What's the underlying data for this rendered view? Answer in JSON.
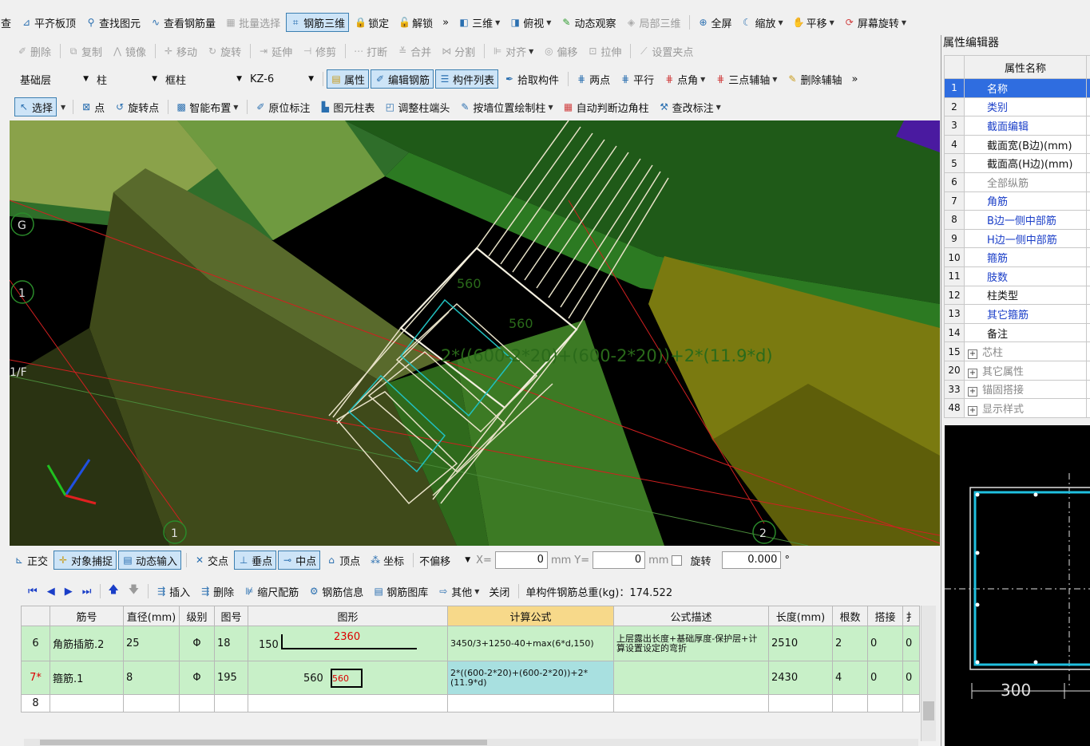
{
  "toolbar1": {
    "items": [
      "查",
      "平齐板顶",
      "查找图元",
      "查看钢筋量",
      "批量选择",
      "钢筋三维",
      "锁定",
      "解锁",
      "»",
      "三维",
      "俯视",
      "动态观察",
      "局部三维",
      "全屏",
      "缩放",
      "平移",
      "屏幕旋转"
    ]
  },
  "toolbar2": {
    "items": [
      "删除",
      "复制",
      "镜像",
      "移动",
      "旋转",
      "延伸",
      "修剪",
      "打断",
      "合并",
      "分割",
      "对齐",
      "偏移",
      "拉伸",
      "设置夹点"
    ]
  },
  "toolbar3": {
    "layer": "基础层",
    "category": "柱",
    "type": "框柱",
    "component": "KZ-6",
    "buttons": [
      "属性",
      "编辑钢筋",
      "构件列表",
      "拾取构件",
      "两点",
      "平行",
      "点角",
      "三点辅轴",
      "删除辅轴"
    ],
    "more": "»"
  },
  "toolbar4": {
    "items": [
      "选择",
      "点",
      "旋转点",
      "智能布置",
      "原位标注",
      "图元柱表",
      "调整柱端头",
      "按墙位置绘制柱",
      "自动判断边角柱",
      "查改标注"
    ]
  },
  "viewport": {
    "axis_labels": [
      "G",
      "1",
      "1/F",
      "1",
      "2"
    ],
    "formula_overlay": "2*((600-2*20)+(600-2*20))+2*(11.9*d)",
    "dim_labels": [
      "560",
      "560"
    ]
  },
  "snapbar": {
    "items": [
      "正交",
      "对象捕捉",
      "动态输入",
      "交点",
      "垂点",
      "中点",
      "顶点",
      "坐标"
    ],
    "offset_mode": "不偏移",
    "x_label": "X=",
    "x_value": "0",
    "y_label": "Y=",
    "y_value": "0",
    "unit": "mm",
    "rotate_label": "旋转",
    "rotate_value": "0.000",
    "degree": "°"
  },
  "rebar_toolbar": {
    "items": [
      "插入",
      "删除",
      "缩尺配筋",
      "钢筋信息",
      "钢筋图库",
      "其他",
      "关闭"
    ],
    "total": "单构件钢筋总重(kg)：174.522"
  },
  "grid": {
    "headers": [
      "",
      "筋号",
      "直径(mm)",
      "级别",
      "图号",
      "图形",
      "计算公式",
      "公式描述",
      "长度(mm)",
      "根数",
      "搭接",
      "扌"
    ],
    "rows": [
      {
        "no": "6",
        "name": "角筋插筋.2",
        "dia": "25",
        "grade": "Φ",
        "fig": "18",
        "shape_left": "150",
        "shape_mid": "2360",
        "formula": "3450/3+1250-40+max(6*d,150)",
        "desc": "上层露出长度+基础厚度-保护层+计算设置设定的弯折",
        "len": "2510",
        "count": "2",
        "lap": "0",
        "extra": "0"
      },
      {
        "no": "7*",
        "name": "箍筋.1",
        "dia": "8",
        "grade": "Φ",
        "fig": "195",
        "shape_left": "560",
        "shape_mid": "560",
        "formula": "2*((600-2*20)+(600-2*20))+2*(11.9*d)",
        "desc": "",
        "len": "2430",
        "count": "4",
        "lap": "0",
        "extra": "0"
      },
      {
        "no": "8",
        "name": "",
        "dia": "",
        "grade": "",
        "fig": "",
        "shape_left": "",
        "shape_mid": "",
        "formula": "",
        "desc": "",
        "len": "",
        "count": "",
        "lap": "",
        "extra": ""
      }
    ]
  },
  "prop_panel": {
    "title": "属性编辑器",
    "header": "属性名称",
    "rows": [
      {
        "n": "1",
        "label": "名称",
        "style": "blue",
        "selected": true
      },
      {
        "n": "2",
        "label": "类别",
        "style": "blue"
      },
      {
        "n": "3",
        "label": "截面编辑",
        "style": "blue"
      },
      {
        "n": "4",
        "label": "截面宽(B边)(mm)",
        "style": "black"
      },
      {
        "n": "5",
        "label": "截面高(H边)(mm)",
        "style": "black"
      },
      {
        "n": "6",
        "label": "全部纵筋",
        "style": "gray"
      },
      {
        "n": "7",
        "label": "角筋",
        "style": "blue"
      },
      {
        "n": "8",
        "label": "B边一侧中部筋",
        "style": "blue"
      },
      {
        "n": "9",
        "label": "H边一侧中部筋",
        "style": "blue"
      },
      {
        "n": "10",
        "label": "箍筋",
        "style": "blue"
      },
      {
        "n": "11",
        "label": "肢数",
        "style": "blue"
      },
      {
        "n": "12",
        "label": "柱类型",
        "style": "black"
      },
      {
        "n": "13",
        "label": "其它箍筋",
        "style": "blue"
      },
      {
        "n": "14",
        "label": "备注",
        "style": "black"
      },
      {
        "n": "15",
        "label": "芯柱",
        "style": "gray",
        "expand": true
      },
      {
        "n": "20",
        "label": "其它属性",
        "style": "gray",
        "expand": true
      },
      {
        "n": "33",
        "label": "锚固搭接",
        "style": "gray",
        "expand": true
      },
      {
        "n": "48",
        "label": "显示样式",
        "style": "gray",
        "expand": true
      }
    ],
    "preview_dim": "300"
  }
}
